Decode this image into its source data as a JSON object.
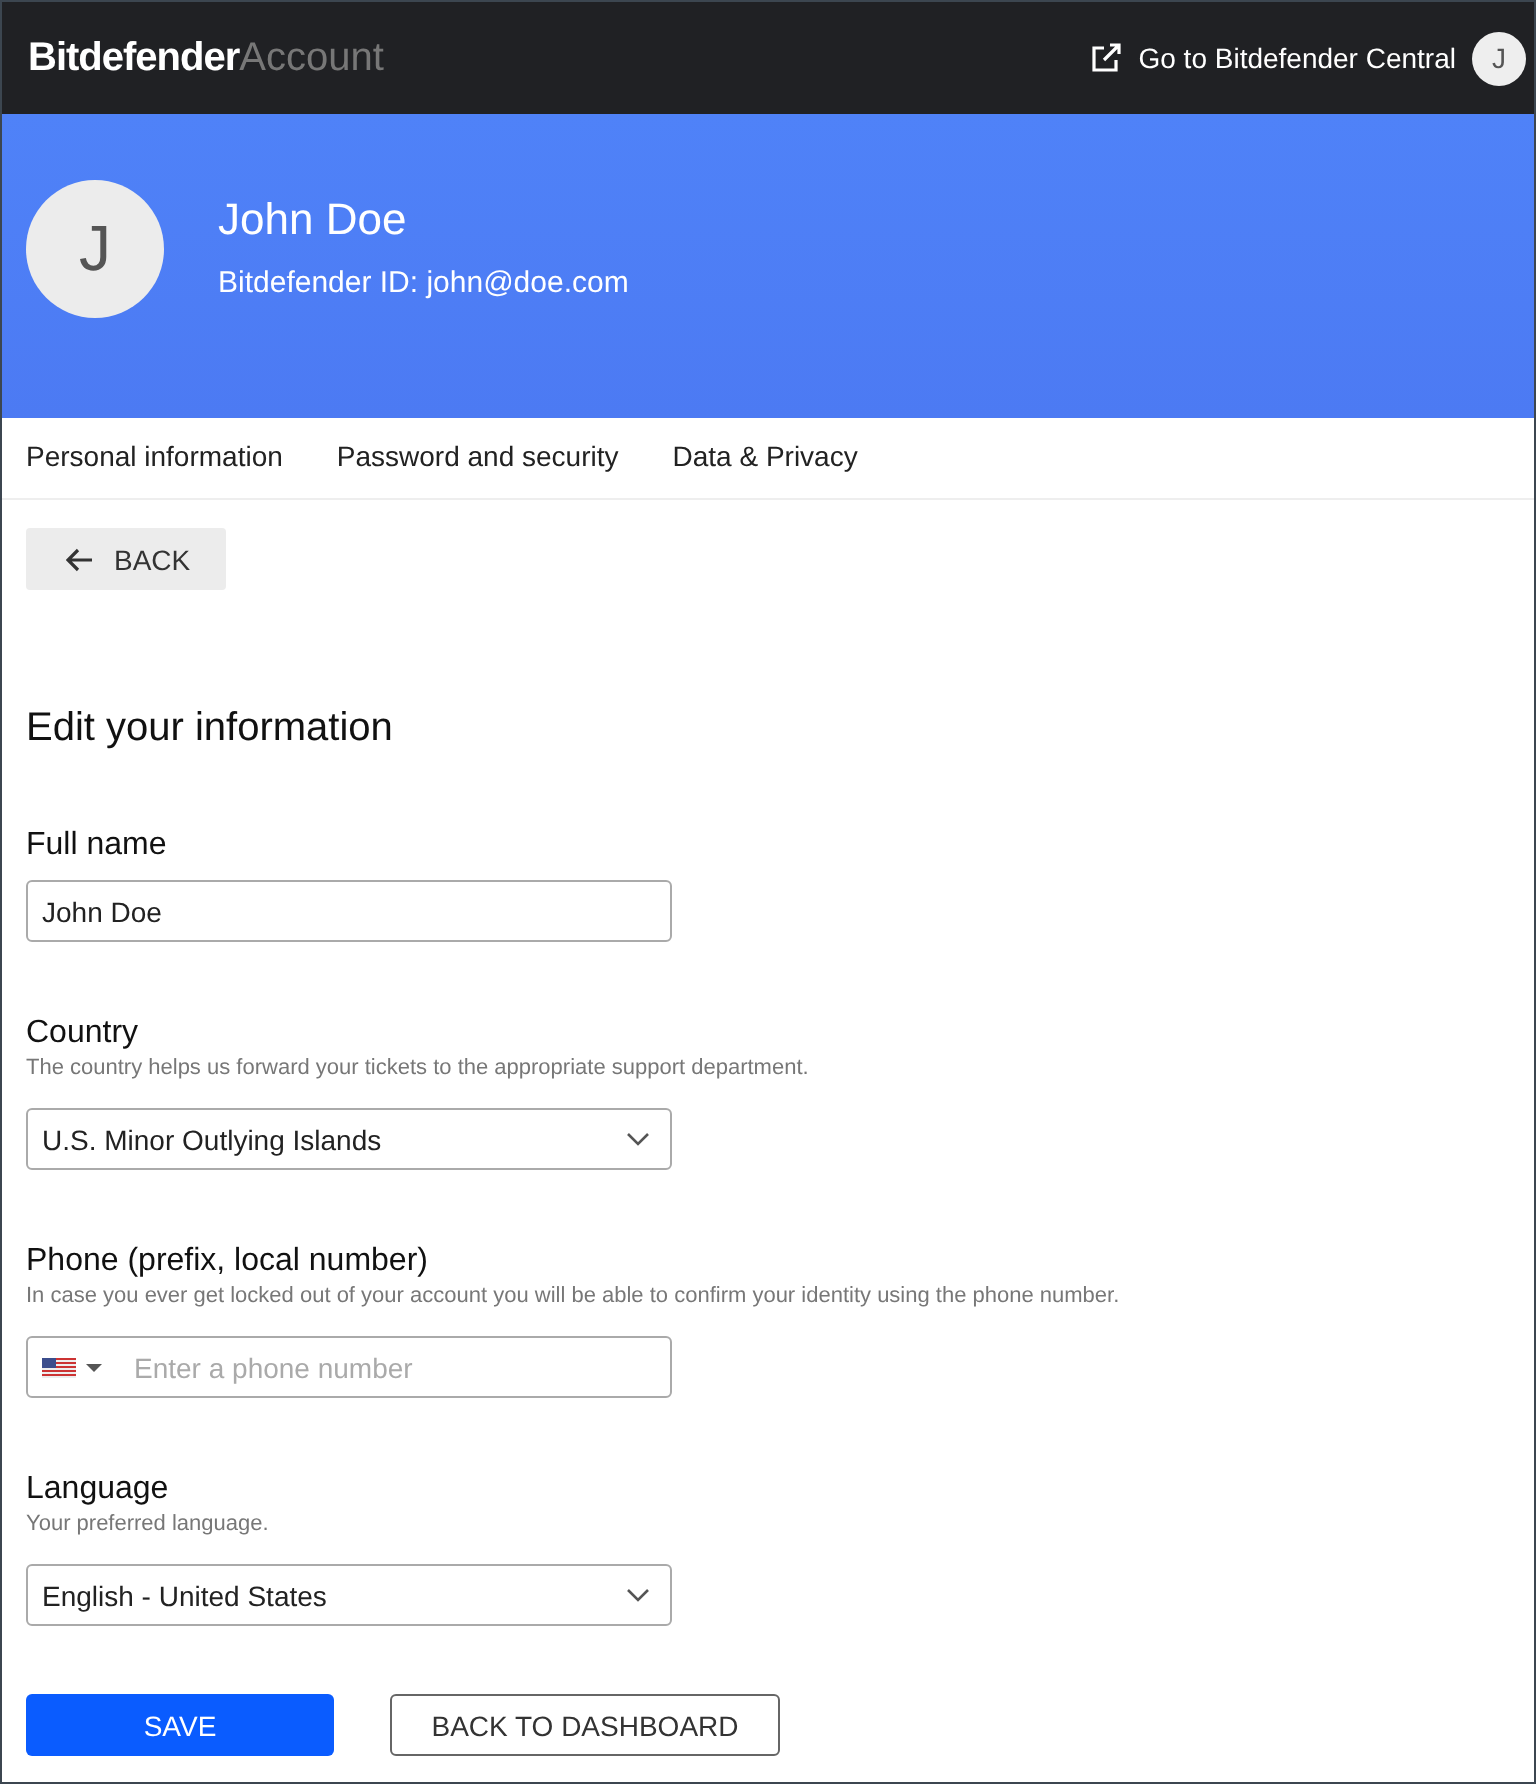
{
  "topbar": {
    "brand": "Bitdefender",
    "brand_suffix": "Account",
    "link": "Go to Bitdefender Central",
    "avatar": "J"
  },
  "profile": {
    "avatar": "J",
    "name": "John Doe",
    "id_line": "Bitdefender ID: john@doe.com"
  },
  "tabs": [
    {
      "label": "Personal information",
      "selected": false
    },
    {
      "label": "Password and security",
      "selected": false
    },
    {
      "label": "Data & Privacy",
      "selected": false
    }
  ],
  "back_button": "BACK",
  "heading": "Edit your information",
  "fields": [
    {
      "kind": "text",
      "label": "Full name",
      "value": "John Doe"
    },
    {
      "kind": "select",
      "label": "Country",
      "hint": "The country helps us forward your tickets to the appropriate support department.",
      "value": "U.S. Minor Outlying Islands"
    },
    {
      "kind": "phone",
      "label": "Phone (prefix, local number)",
      "hint": "In case you ever get locked out of your account you will be able to confirm your identity using the phone number.",
      "placeholder": "Enter a phone number"
    },
    {
      "kind": "select",
      "label": "Language",
      "hint": "Your preferred language.",
      "value": "English - United States"
    }
  ],
  "buttons": [
    {
      "kind": "primary",
      "label": "SAVE"
    },
    {
      "kind": "outline",
      "label": "BACK TO DASHBOARD"
    }
  ]
}
